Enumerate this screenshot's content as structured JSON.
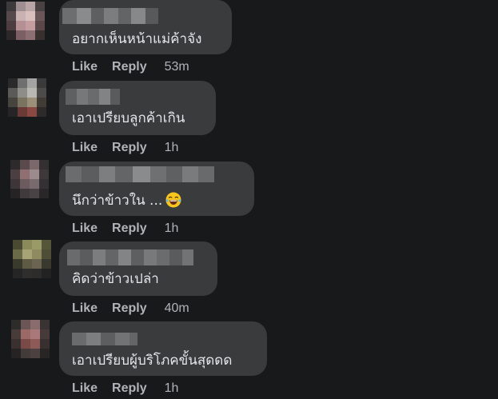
{
  "comments": [
    {
      "text": "อยากเห็นหน้าแม่ค้าจัง",
      "like_label": "Like",
      "reply_label": "Reply",
      "time": "53m"
    },
    {
      "text": "เอาเปรียบลูกค้าเกิน",
      "like_label": "Like",
      "reply_label": "Reply",
      "time": "1h"
    },
    {
      "text": "นึกว่าข้าวใน ...",
      "emoji_icon": "face-with-tears-of-joy-icon",
      "like_label": "Like",
      "reply_label": "Reply",
      "time": "1h"
    },
    {
      "text": "คิดว่าข้าวเปล่า",
      "like_label": "Like",
      "reply_label": "Reply",
      "time": "40m"
    },
    {
      "text": "เอาเปรียบผู้บริโภคขั้นสุดดด",
      "like_label": "Like",
      "reply_label": "Reply",
      "time": "1h"
    }
  ],
  "colors": {
    "background": "#18191a",
    "bubble": "#3a3b3c",
    "text": "#e4e6eb",
    "secondary_text": "#b0b3b8"
  }
}
